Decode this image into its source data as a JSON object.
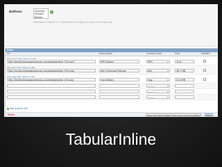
{
  "slide": {
    "title": "TabularInline"
  },
  "authors": {
    "label": "Authors:",
    "options": [
      "Ehrovsky",
      "Hilsdale",
      "Bowser"
    ],
    "help": "Hold down \"Control\", or \"Command\" on a Mac, to select more than one."
  },
  "inline": {
    "module_title": "Files",
    "headers": {
      "url": "Url",
      "description": "Description",
      "content_type": "Content type",
      "size": "Size",
      "delete": "Delete?"
    },
    "rows": [
      {
        "original": "test_mp3.mp3: View on site",
        "url": "http://media.throwawaydjango.com/episodes/test_033.mp3",
        "description": "MP3 Edition",
        "content_type": "MP3",
        "size": "41.8"
      },
      {
        "original": "test_aac.m4a: View on site",
        "url": "http://media.throwawaydjango.com/episodes/test_033.m4a",
        "description": "AAC Enhanced Podcast",
        "content_type": "AAC",
        "size": "46.7 MB"
      },
      {
        "original": "test_ogg.ogg: View on site",
        "url": "http://media.throwawaydjango.com/episodes/test_033.ogg",
        "description": "Ogg Edition",
        "content_type": "Ogg",
        "size": "51.9 MB"
      },
      {
        "original": "",
        "url": "",
        "description": "",
        "content_type": "---------",
        "size": ""
      },
      {
        "original": "",
        "url": "",
        "description": "",
        "content_type": "---------",
        "size": ""
      },
      {
        "original": "",
        "url": "",
        "description": "",
        "content_type": "---------",
        "size": ""
      }
    ],
    "add_another": "Add another File"
  },
  "submit": {
    "delete": "Delete",
    "save_add": "Save and add another",
    "save_continue": "Save and continue editing",
    "save": "Save"
  }
}
